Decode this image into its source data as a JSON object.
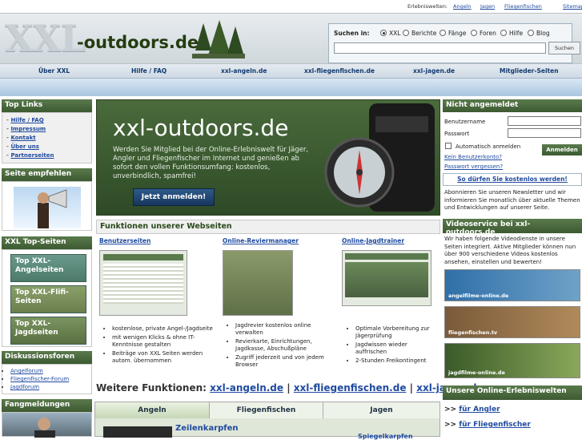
{
  "topstrip": {
    "label": "Erlebniswelten:",
    "links": [
      "Angeln",
      "Jagen",
      "Fliegenfischen",
      "Sitemap"
    ]
  },
  "header": {
    "logo_xxl": "XXL",
    "logo_text": "-outdoors.de"
  },
  "search": {
    "label": "Suchen in:",
    "options": [
      "XXL",
      "Berichte",
      "Fänge",
      "Foren",
      "Hilfe",
      "Blog"
    ],
    "selected": "XXL",
    "value": "",
    "button": "Suchen"
  },
  "nav": [
    "Über XXL",
    "Hilfe / FAQ",
    "xxl-angeln.de",
    "xxl-fliegenfischen.de",
    "xxl-jagen.de",
    "Mitglieder-Seiten"
  ],
  "left": {
    "toplinks_title": "Top Links",
    "toplinks": [
      "Hilfe / FAQ",
      "Impressum",
      "Kontakt",
      "Über uns",
      "Partnerseiten"
    ],
    "recommend_title": "Seite empfehlen",
    "topseiten_title": "XXL Top-Seiten",
    "topseiten": [
      "Top XXL-Angelseiten",
      "Top XXL-Flifi-Seiten",
      "Top XXL-Jagdseiten"
    ],
    "forums_title": "Diskussionsforen",
    "forums": [
      "Angelforum",
      "Fliegenfischer-Forum",
      "Jagdforum"
    ],
    "catches_title": "Fangmeldungen"
  },
  "hero": {
    "title": "xxl-outdoors.de",
    "text": "Werden Sie Mitglied bei der Online-Erlebniswelt für Jäger, Angler und Fliegenfischer im Internet und genießen ab sofort den vollen Funktionsumfang: kostenlos, unverbindlich, spamfrei!",
    "button": "Jetzt anmelden!"
  },
  "functions": {
    "title": "Funktionen unserer Webseiten",
    "cols": [
      {
        "title": "Benutzerseiten",
        "bullets": [
          "kostenlose, private Angel-/Jagdseite",
          "mit wenigen Klicks & ohne IT-Kenntnisse gestalten",
          "Beiträge von XXL Seiten werden autom. übernommen"
        ]
      },
      {
        "title": "Online-Reviermanager",
        "bullets": [
          "Jagdrevier kostenlos online verwalten",
          "Revierkarte, Einrichtungen, Jagdkasse, Abschußpläne",
          "Zugriff jederzeit und von jedem Browser"
        ]
      },
      {
        "title": "Online-Jagdtrainer",
        "bullets": [
          "Optimale Vorbereitung zur Jägerprüfung",
          "Jagdwissen wieder auffrischen",
          "2-Stunden Freikontingent"
        ]
      }
    ]
  },
  "more": {
    "label": "Weitere Funktionen:",
    "links": [
      "xxl-angeln.de",
      "xxl-fliegenfischen.de",
      "xxl-jagen.de"
    ],
    "sep": "|"
  },
  "tabs": {
    "items": [
      "Angeln",
      "Fliegenfischen",
      "Jagen"
    ],
    "article_title": "Zeilenkarpfen",
    "article_title2": "Spiegelkarpfen"
  },
  "login": {
    "title": "Nicht angemeldet",
    "user_label": "Benutzername",
    "pass_label": "Passwort",
    "auto_label": "Automatisch anmelden",
    "button": "Anmelden",
    "no_account": "Kein Benutzerkonto?",
    "forgot": "Passwort vergessen?"
  },
  "free": {
    "title": "So dürfen Sie kostenlos werden!",
    "text": "Abonnieren Sie unseren Newsletter und wir informieren Sie monatlich über aktuelle Themen und Entwicklungen auf unserer Seite."
  },
  "video": {
    "title": "Videoservice bei xxl-outdoors.de",
    "text": "Wir haben folgende Videodienste in unsere Seiten integriert. Aktive Mitglieder können nun über 900 verschiedene Videos kostenlos ansehen, einstellen und bewerten!",
    "banners": [
      "angelfilme-online.de",
      "fliegenfischen.tv",
      "jagdfilme-online.de"
    ]
  },
  "worlds": {
    "title": "Unsere Online-Erlebniswelten",
    "items": [
      "für Angler",
      "für Fliegenfischer"
    ]
  }
}
